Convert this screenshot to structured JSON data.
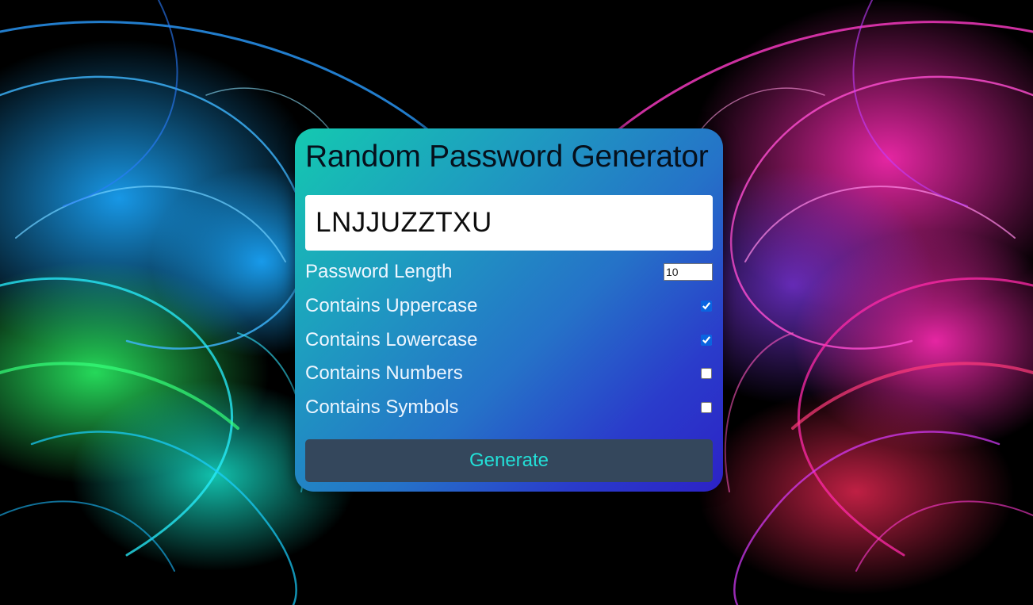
{
  "app": {
    "title": "Random Password Generator"
  },
  "result": {
    "password": "LNJJUZZTXU"
  },
  "settings": {
    "length": {
      "label": "Password Length",
      "value": "10"
    },
    "uppercase": {
      "label": "Contains Uppercase",
      "checked": true
    },
    "lowercase": {
      "label": "Contains Lowercase",
      "checked": true
    },
    "numbers": {
      "label": "Contains Numbers",
      "checked": false
    },
    "symbols": {
      "label": "Contains Symbols",
      "checked": false
    }
  },
  "actions": {
    "generate_label": "Generate"
  },
  "colors": {
    "button_bg": "#34475c",
    "button_text": "#22e0d8",
    "card_gradient_start": "#14c9b0",
    "card_gradient_end": "#2c22c6",
    "background_left_accent": "#1aa8ff",
    "background_right_accent": "#ff2ab4"
  }
}
